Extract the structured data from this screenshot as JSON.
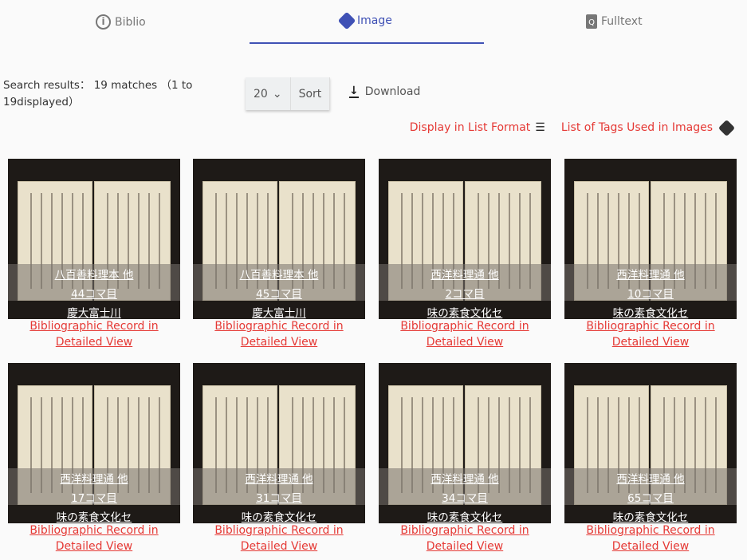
{
  "tabs": [
    {
      "label": "Biblio",
      "icon": "info-icon"
    },
    {
      "label": "Image",
      "icon": "tag-icon"
    },
    {
      "label": "Fulltext",
      "icon": "file-search-icon"
    }
  ],
  "active_tab": "Image",
  "results_text": "Search results： 19 matches （1 to 19displayed）",
  "per_page": "20",
  "sort_label": "Sort",
  "download_label": "Download",
  "list_format_label": "Display in List Format",
  "tags_label": "List of Tags Used in Images",
  "accent_color": "#3f51b5",
  "link_color": "#e53935",
  "record_link": "Bibliographic Record in Detailed View",
  "cards": [
    {
      "title": "八百善料理本 他",
      "frame": "44コマ目",
      "holder": "慶大富士川"
    },
    {
      "title": "八百善料理本 他",
      "frame": "45コマ目",
      "holder": "慶大富士川"
    },
    {
      "title": "西洋料理通 他",
      "frame": "2コマ目",
      "holder": "味の素食文化セ"
    },
    {
      "title": "西洋料理通 他",
      "frame": "10コマ目",
      "holder": "味の素食文化セ"
    },
    {
      "title": "西洋料理通 他",
      "frame": "17コマ目",
      "holder": "味の素食文化セ"
    },
    {
      "title": "西洋料理通 他",
      "frame": "31コマ目",
      "holder": "味の素食文化セ"
    },
    {
      "title": "西洋料理通 他",
      "frame": "34コマ目",
      "holder": "味の素食文化セ"
    },
    {
      "title": "西洋料理通 他",
      "frame": "65コマ目",
      "holder": "味の素食文化セ"
    }
  ]
}
